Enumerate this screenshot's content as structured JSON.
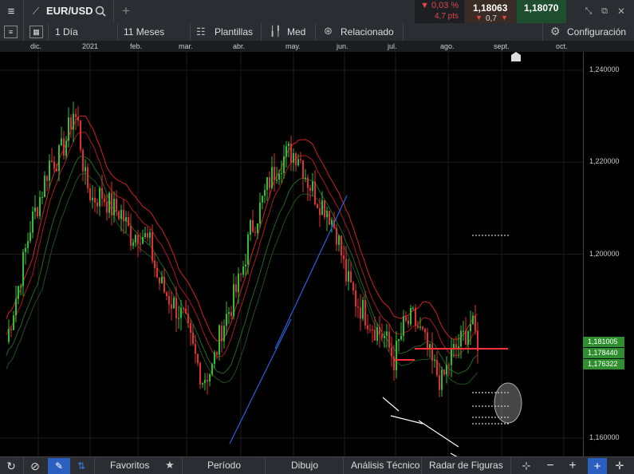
{
  "toolbar": {
    "symbol": "EUR/USD",
    "change_pct": "▼ 0,03 %",
    "change_pts": "4,7 pts",
    "bid": "1,18063",
    "ask": "1,18070",
    "spread": "0,7",
    "period_label": "1 Día",
    "range_label": "11 Meses",
    "templates_label": "Plantillas",
    "med_label": "Med",
    "related_label": "Relacionado",
    "config_label": "Configuración"
  },
  "bottom": {
    "favorites": "Favoritos",
    "period": "Período",
    "drawing": "Dibujo",
    "technical": "Análisis Técnico",
    "patterns": "Radar de Figuras"
  },
  "colors": {
    "up": "#2fbf2f",
    "down": "#e03030",
    "bg": "#000000",
    "tag": "#2f8f2f"
  },
  "chart_data": {
    "type": "candlestick",
    "months": [
      "dic.",
      "2021",
      "feb.",
      "mar.",
      "abr.",
      "may.",
      "jun.",
      "jul.",
      "ago.",
      "sept.",
      "oct."
    ],
    "y_ticks": [
      "1,240000",
      "1,220000",
      "1,200000",
      "1,160000"
    ],
    "ylim": [
      1.156,
      1.244
    ],
    "price_tags": [
      "1,181005",
      "1,178440",
      "1,176322"
    ],
    "close_path": [
      [
        0,
        1.181
      ],
      [
        5,
        1.193
      ],
      [
        10,
        1.206
      ],
      [
        15,
        1.214
      ],
      [
        18,
        1.22
      ],
      [
        22,
        1.221
      ],
      [
        25,
        1.225
      ],
      [
        28,
        1.231
      ],
      [
        30,
        1.228
      ],
      [
        33,
        1.216
      ],
      [
        36,
        1.212
      ],
      [
        40,
        1.213
      ],
      [
        44,
        1.21
      ],
      [
        48,
        1.209
      ],
      [
        52,
        1.204
      ],
      [
        56,
        1.205
      ],
      [
        60,
        1.202
      ],
      [
        63,
        1.195
      ],
      [
        66,
        1.192
      ],
      [
        70,
        1.189
      ],
      [
        74,
        1.186
      ],
      [
        78,
        1.179
      ],
      [
        82,
        1.173
      ],
      [
        86,
        1.175
      ],
      [
        90,
        1.184
      ],
      [
        94,
        1.189
      ],
      [
        98,
        1.195
      ],
      [
        102,
        1.205
      ],
      [
        106,
        1.21
      ],
      [
        110,
        1.216
      ],
      [
        114,
        1.22
      ],
      [
        118,
        1.222
      ],
      [
        122,
        1.222
      ],
      [
        126,
        1.216
      ],
      [
        130,
        1.212
      ],
      [
        134,
        1.21
      ],
      [
        138,
        1.205
      ],
      [
        142,
        1.195
      ],
      [
        146,
        1.19
      ],
      [
        150,
        1.187
      ],
      [
        154,
        1.184
      ],
      [
        158,
        1.182
      ],
      [
        162,
        1.177
      ],
      [
        166,
        1.184
      ],
      [
        170,
        1.186
      ],
      [
        174,
        1.182
      ],
      [
        178,
        1.176
      ],
      [
        182,
        1.172
      ],
      [
        186,
        1.178
      ],
      [
        190,
        1.181
      ],
      [
        194,
        1.185
      ],
      [
        197,
        1.181
      ]
    ],
    "day_count": 197
  }
}
